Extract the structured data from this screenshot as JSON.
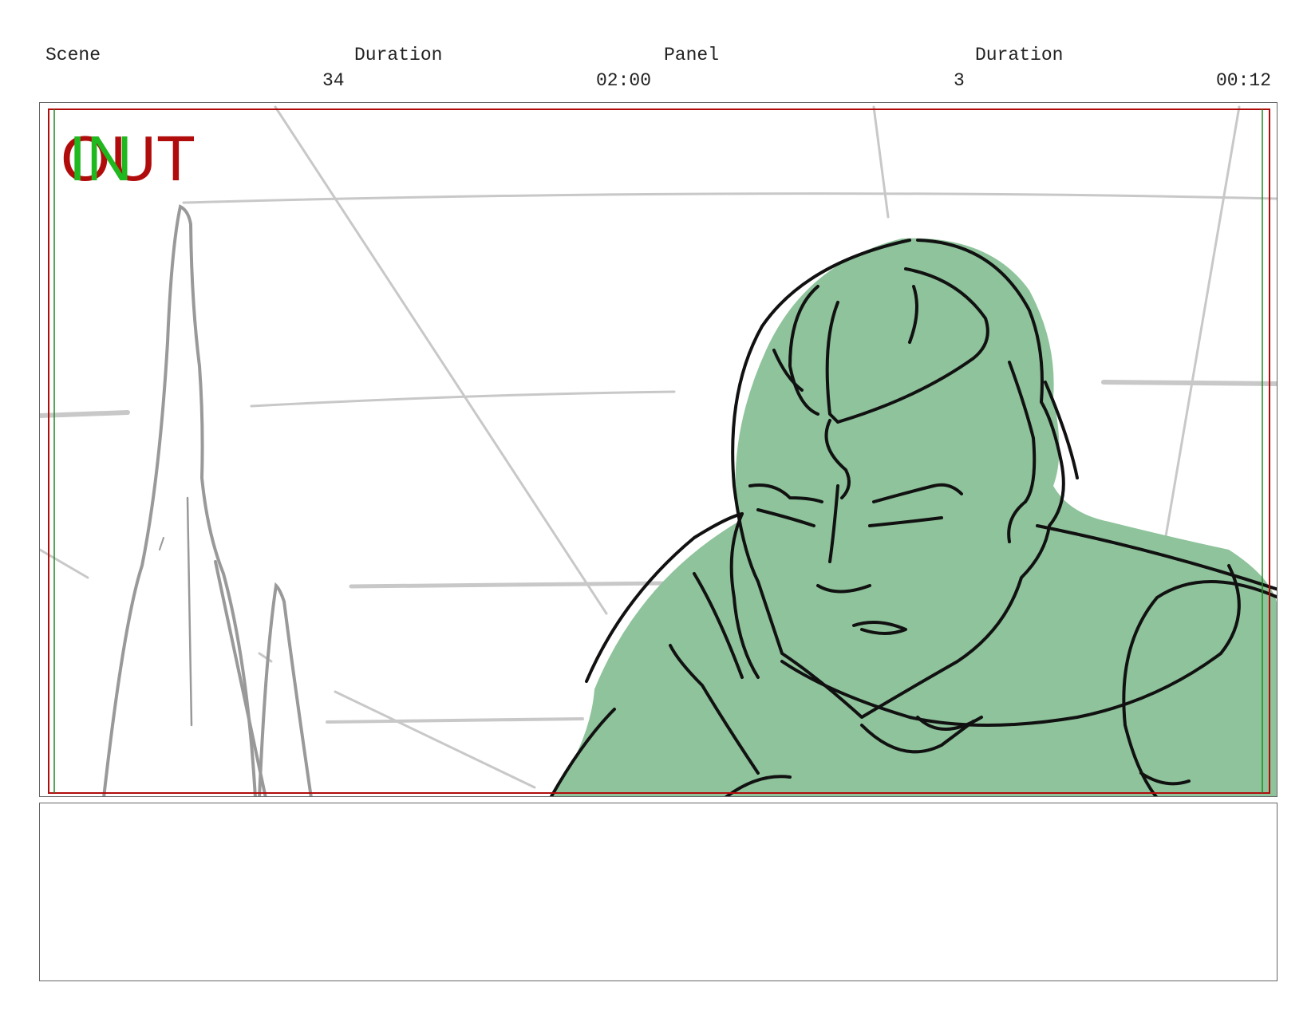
{
  "header": {
    "scene_label": "Scene",
    "scene_duration_label": "Duration",
    "panel_label": "Panel",
    "panel_duration_label": "Duration",
    "scene_value": "34",
    "scene_duration_value": "02:00",
    "panel_value": "3",
    "panel_duration_value": "00:12"
  },
  "panel": {
    "in_label": "IN",
    "out_label": "OUT",
    "colors": {
      "safe_frame": "#b10c0c",
      "in_marker": "#1fb81f",
      "character_fill": "#8ec39b",
      "sketch_line": "#c8c8c8",
      "ink": "#111111"
    }
  },
  "notes": {
    "text": ""
  }
}
